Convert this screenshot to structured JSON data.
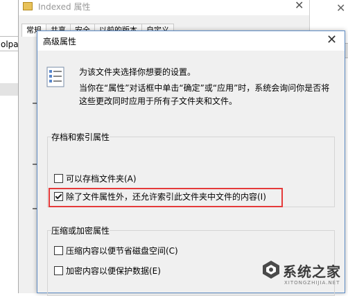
{
  "background": {
    "left_input_text": "olpa",
    "props_window": {
      "title": "Indexed 属性",
      "tabs": [
        "常规",
        "共享",
        "安全",
        "以前的版本",
        "自定义"
      ]
    }
  },
  "dialog": {
    "title": "高级属性",
    "intro": "为该文件夹选择你想要的设置。",
    "description": "当你在“属性”对话框中单击“确定”或“应用”时，系统会询问你是否将这些更改同时应用于所有子文件夹和文件。",
    "archive_group": {
      "title": "存档和索引属性",
      "options": [
        {
          "label": "可以存档文件夹(A)",
          "checked": false
        },
        {
          "label": "除了文件属性外，还允许索引此文件夹中文件的内容(I)",
          "checked": true
        }
      ]
    },
    "compress_group": {
      "title": "压缩或加密属性",
      "options": [
        {
          "label": "压缩内容以便节省磁盘空间(C)",
          "checked": false
        },
        {
          "label": "加密内容以便保护数据(E)",
          "checked": false
        }
      ]
    }
  },
  "watermark": {
    "text": "系统之家",
    "subtext": "XITONGZHIJIA.NET"
  },
  "colors": {
    "highlight": "#e53a3a",
    "dialog_border": "#5d8bc4"
  },
  "icons": {
    "dialog_icon": "document-list-icon",
    "close": "close-icon"
  }
}
